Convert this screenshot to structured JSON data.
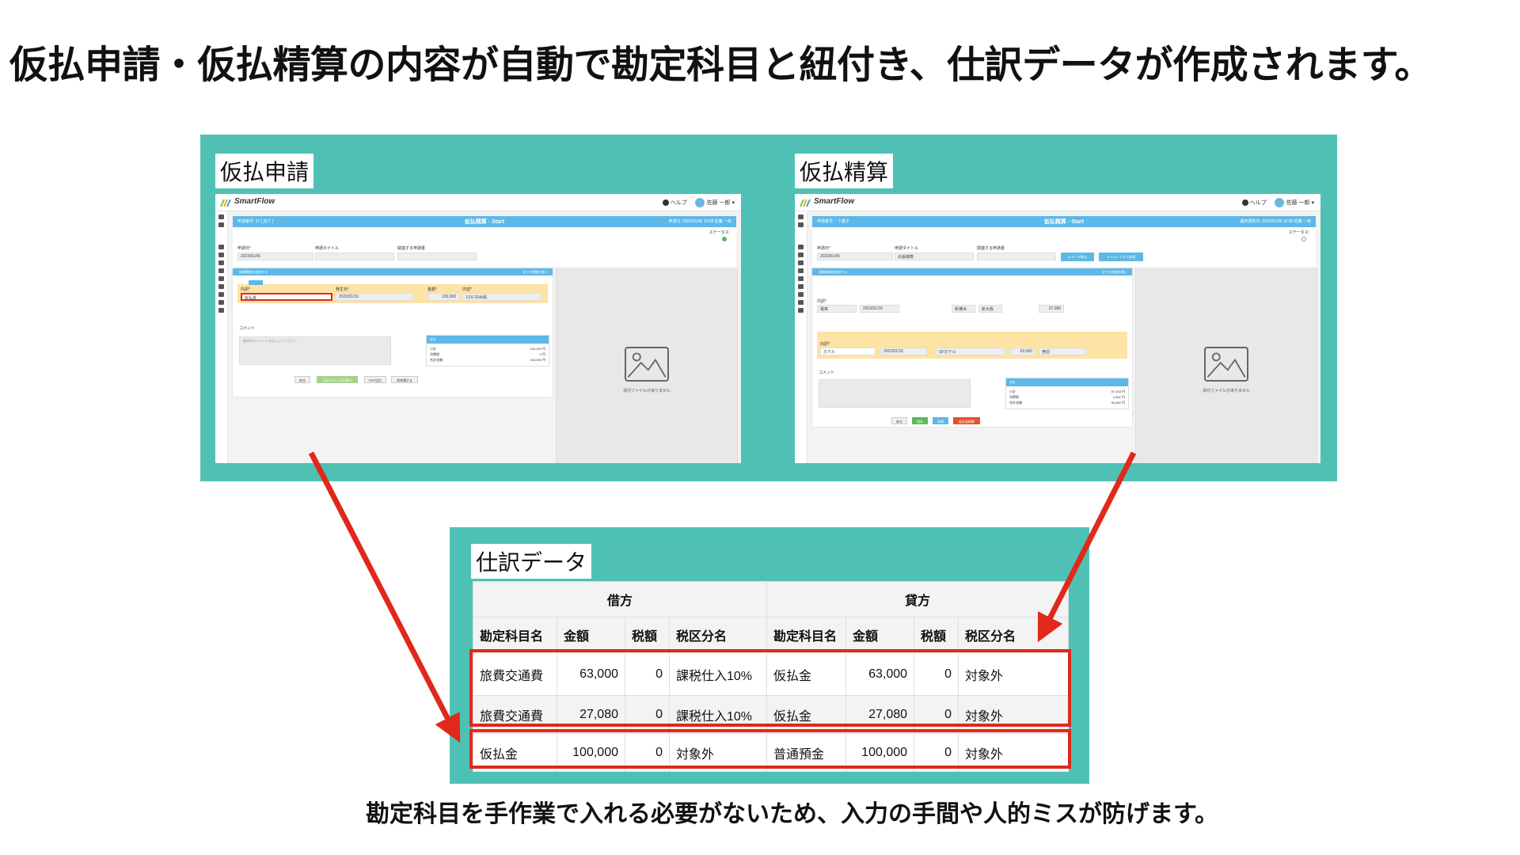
{
  "headline": "仮払申請・仮払精算の内容が自動で勘定科目と紐付き、仕訳データが作成されます。",
  "footer_note": "勘定科目を手作業で入れる必要がないため、入力の手間や人的ミスが防げます。",
  "colors": {
    "teal": "#4fc1b4",
    "red_highlight": "#e0291b",
    "app_blue": "#5cb8e6",
    "app_yellow": "#fde3a4"
  },
  "panels": {
    "advance_request": {
      "label": "仮払申請",
      "screenshot": {
        "logo": "SmartFlow",
        "help": "ヘルプ",
        "user": "佐藤 一郎",
        "header_left": "申請番号: 37 [ 完了 ]",
        "header_title": "仮払精算 - Start",
        "header_right": "申請日: 2023/01/06 10:38 佐藤 一郎",
        "status_label": "ステータス:",
        "fields": {
          "date_label": "申請日*",
          "date_value": "2023/01/06",
          "title_label": "申請タイトル",
          "related_label": "関連する申請書"
        },
        "detail_header": "詳細情報を追加する",
        "detail_right": "全ての明細を開く",
        "row": {
          "account_label": "内訳*",
          "account_value": "仮払金",
          "date_label": "発生日*",
          "date_value": "2023/01/16",
          "amount_label": "金額*",
          "amount_value": "100,000",
          "memo_label": "内容*",
          "memo_value": "1/16-20出張"
        },
        "comment_label": "コメント",
        "comment_placeholder": "最終的なコメントを記入してください",
        "summary": {
          "title": "合計",
          "subtotal_label": "小計",
          "subtotal": "100,000 円",
          "tax_label": "消費税",
          "tax": "0 円",
          "total_label": "合計金額",
          "total": "100,000 円"
        },
        "buttons": [
          "戻る",
          "元のステップに移行",
          "PDF出力",
          "再申請する"
        ],
        "no_attachment": "添付ファイルがありません"
      }
    },
    "advance_settlement": {
      "label": "仮払精算",
      "screenshot": {
        "logo": "SmartFlow",
        "help": "ヘルプ",
        "user": "佐藤 一郎",
        "header_left": "申請番号: - 下書き",
        "header_title": "仮払精算 - Start",
        "header_right": "最終更新日: 2023/01/06 10:38 佐藤 一郎",
        "status_label": "ステータス:",
        "fields": {
          "date_label": "申請日*",
          "date_value": "2023/01/06",
          "title_label": "申請タイトル",
          "title_value": "出張精算",
          "related_label": "関連する申請書"
        },
        "top_buttons": [
          "ICデータ取込",
          "マイルートから申請"
        ],
        "detail_header": "詳細情報を追加する",
        "detail_right": "全ての明細を開く",
        "row1": {
          "account_label": "内訳*",
          "account_value": "電車",
          "date_value": "2023/01/16",
          "from": "新横浜",
          "to": "新大阪",
          "amount": "27,080"
        },
        "row2": {
          "account_label": "内訳*",
          "account_value": "ホテル",
          "date_value": "2023/01/16",
          "place": "SFホテル",
          "amount": "63,000",
          "memo": "宿泊"
        },
        "comment_label": "コメント",
        "summary": {
          "title": "合計",
          "subtotal_label": "小計",
          "subtotal": "87,418 円",
          "tax_label": "消費税",
          "tax": "2,662 円",
          "total_label": "合計金額",
          "total": "90,080 円"
        },
        "buttons": [
          "戻る",
          "保存",
          "申請",
          "仮払金精算"
        ],
        "no_attachment": "添付ファイルがありません"
      }
    },
    "journal": {
      "label": "仕訳データ",
      "group_headers": [
        "借方",
        "貸方"
      ],
      "columns": [
        "勘定科目名",
        "金額",
        "税額",
        "税区分名",
        "勘定科目名",
        "金額",
        "税額",
        "税区分名"
      ],
      "rows": [
        [
          "旅費交通費",
          "63,000",
          "0",
          "課税仕入10%",
          "仮払金",
          "63,000",
          "0",
          "対象外"
        ],
        [
          "旅費交通費",
          "27,080",
          "0",
          "課税仕入10%",
          "仮払金",
          "27,080",
          "0",
          "対象外"
        ],
        [
          "仮払金",
          "100,000",
          "0",
          "対象外",
          "普通預金",
          "100,000",
          "0",
          "対象外"
        ]
      ]
    }
  }
}
